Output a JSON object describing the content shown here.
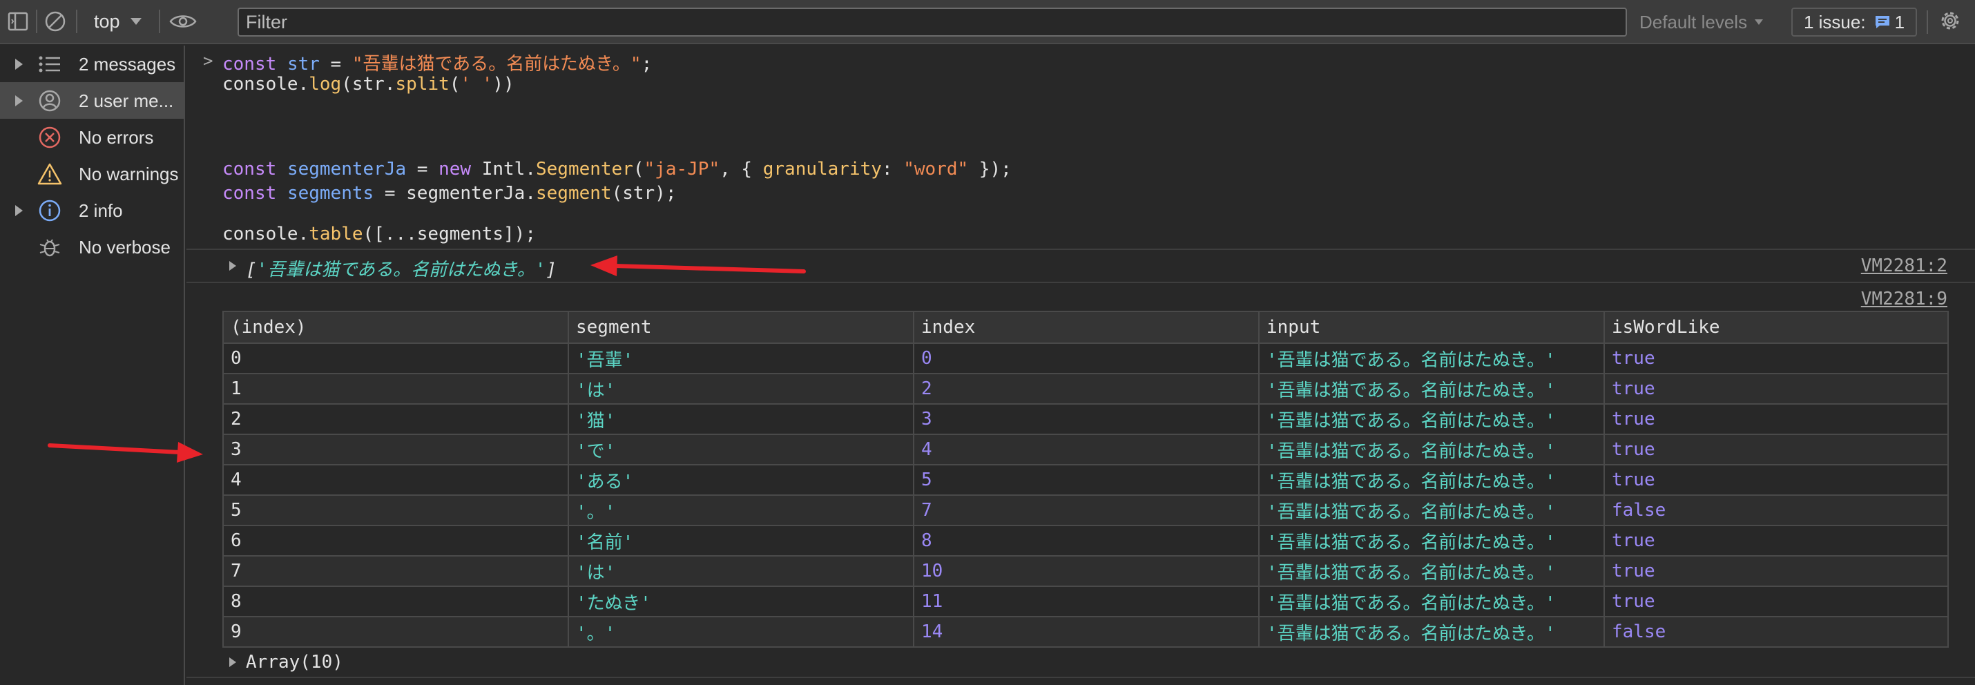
{
  "toolbar": {
    "context": "top",
    "filter_placeholder": "Filter",
    "levels": "Default levels",
    "issues_label": "1 issue:",
    "issues_count": "1"
  },
  "sidebar": {
    "items": [
      {
        "label": "2 messages",
        "icon": "list-icon"
      },
      {
        "label": "2 user me...",
        "icon": "user-icon"
      },
      {
        "label": "No errors",
        "icon": "error-icon"
      },
      {
        "label": "No warnings",
        "icon": "warning-icon"
      },
      {
        "label": "2 info",
        "icon": "info-icon"
      },
      {
        "label": "No verbose",
        "icon": "bug-icon"
      }
    ]
  },
  "code": {
    "l1_kw": "const",
    "l1_var": "str",
    "l1_eq": " = ",
    "l1_str": "\"吾輩は猫である。名前はたぬき。\"",
    "l1_end": ";",
    "l2_a": "console.",
    "l2_fn": "log",
    "l2_b": "(str.",
    "l2_fn2": "split",
    "l2_c": "(",
    "l2_str": "' '",
    "l2_d": "))",
    "l3_kw": "const",
    "l3_var": "segmenterJa",
    "l3_eq": " = ",
    "l3_new": "new",
    "l3_a": " Intl.",
    "l3_fn": "Segmenter",
    "l3_b": "(",
    "l3_str": "\"ja-JP\"",
    "l3_c": ", { ",
    "l3_prop": "granularity",
    "l3_d": ": ",
    "l3_str2": "\"word\"",
    "l3_e": " });",
    "l4_kw": "const",
    "l4_var": "segments",
    "l4_a": " = segmenterJa.",
    "l4_fn": "segment",
    "l4_b": "(str);",
    "l5_a": "console.",
    "l5_fn": "table",
    "l5_b": "([...segments]);"
  },
  "output": {
    "array_open": "[",
    "array_value": "'吾輩は猫である。名前はたぬき。'",
    "array_close": "]",
    "src1": "VM2281:2",
    "src2": "VM2281:9",
    "array_summary": "Array(10)"
  },
  "table": {
    "headers": [
      "(index)",
      "segment",
      "index",
      "input",
      "isWordLike"
    ],
    "rows": [
      [
        "0",
        "'吾輩'",
        "0",
        "'吾輩は猫である。名前はたぬき。'",
        "true"
      ],
      [
        "1",
        "'は'",
        "2",
        "'吾輩は猫である。名前はたぬき。'",
        "true"
      ],
      [
        "2",
        "'猫'",
        "3",
        "'吾輩は猫である。名前はたぬき。'",
        "true"
      ],
      [
        "3",
        "'で'",
        "4",
        "'吾輩は猫である。名前はたぬき。'",
        "true"
      ],
      [
        "4",
        "'ある'",
        "5",
        "'吾輩は猫である。名前はたぬき。'",
        "true"
      ],
      [
        "5",
        "'。'",
        "7",
        "'吾輩は猫である。名前はたぬき。'",
        "false"
      ],
      [
        "6",
        "'名前'",
        "8",
        "'吾輩は猫である。名前はたぬき。'",
        "true"
      ],
      [
        "7",
        "'は'",
        "10",
        "'吾輩は猫である。名前はたぬき。'",
        "true"
      ],
      [
        "8",
        "'たぬき'",
        "11",
        "'吾輩は猫である。名前はたぬき。'",
        "true"
      ],
      [
        "9",
        "'。'",
        "14",
        "'吾輩は猫である。名前はたぬき。'",
        "false"
      ]
    ]
  },
  "colors": {
    "annotation_arrow": "#e8232a",
    "string": "#f28b54",
    "keyword": "#c58af9",
    "variable": "#7cacf8",
    "segment": "#5cd5c5",
    "number": "#9a88f5"
  }
}
